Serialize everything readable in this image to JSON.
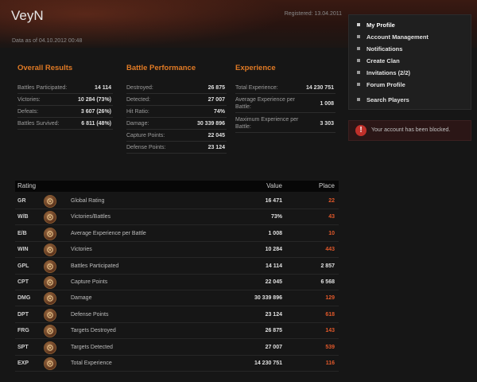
{
  "header": {
    "username": "VeyN",
    "registered": "Registered: 13.04.2011",
    "data_as_of": "Data as of 04.10.2012 00:48"
  },
  "menu": {
    "items": [
      {
        "label": "My Profile",
        "active": true
      },
      {
        "label": "Account Management"
      },
      {
        "label": "Notifications"
      },
      {
        "label": "Create Clan"
      },
      {
        "label": "Invitations (2/2)"
      },
      {
        "label": "Forum Profile"
      },
      {
        "label": "Search Players"
      }
    ]
  },
  "alert": {
    "text": "Your account has been blocked.",
    "icon": "exclamation-icon",
    "color": "#c0302a"
  },
  "overall": {
    "title": "Overall Results",
    "rows": [
      {
        "label": "Battles Participated:",
        "value": "14 114"
      },
      {
        "label": "Victories:",
        "value": "10 284 (73%)"
      },
      {
        "label": "Defeats:",
        "value": "3 607 (26%)"
      },
      {
        "label": "Battles Survived:",
        "value": "6 811 (48%)"
      }
    ]
  },
  "battle": {
    "title": "Battle Performance",
    "rows": [
      {
        "label": "Destroyed:",
        "value": "26 875"
      },
      {
        "label": "Detected:",
        "value": "27 007"
      },
      {
        "label": "Hit Ratio:",
        "value": "74%"
      },
      {
        "label": "Damage:",
        "value": "30 339 896"
      },
      {
        "label": "Capture Points:",
        "value": "22 045"
      },
      {
        "label": "Defense Points:",
        "value": "23 124"
      }
    ]
  },
  "experience": {
    "title": "Experience",
    "rows": [
      {
        "label": "Total Experience:",
        "value": "14 230 751"
      },
      {
        "label": "Average Experience per Battle:",
        "value": "1 008"
      },
      {
        "label": "Maximum Experience per Battle:",
        "value": "3 303"
      }
    ]
  },
  "rating": {
    "headers": {
      "rating": "Rating",
      "value": "Value",
      "place": "Place"
    },
    "rows": [
      {
        "abbr": "GR",
        "name": "Global Rating",
        "value": "16 471",
        "place": "22",
        "highlight": true
      },
      {
        "abbr": "W/B",
        "name": "Victories/Battles",
        "value": "73%",
        "place": "43",
        "highlight": true
      },
      {
        "abbr": "E/B",
        "name": "Average Experience per Battle",
        "value": "1 008",
        "place": "10",
        "highlight": true
      },
      {
        "abbr": "WIN",
        "name": "Victories",
        "value": "10 284",
        "place": "443",
        "highlight": true
      },
      {
        "abbr": "GPL",
        "name": "Battles Participated",
        "value": "14 114",
        "place": "2 857",
        "highlight": false
      },
      {
        "abbr": "CPT",
        "name": "Capture Points",
        "value": "22 045",
        "place": "6 568",
        "highlight": false
      },
      {
        "abbr": "DMG",
        "name": "Damage",
        "value": "30 339 896",
        "place": "129",
        "highlight": true
      },
      {
        "abbr": "DPT",
        "name": "Defense Points",
        "value": "23 124",
        "place": "618",
        "highlight": true
      },
      {
        "abbr": "FRG",
        "name": "Targets Destroyed",
        "value": "26 875",
        "place": "143",
        "highlight": true
      },
      {
        "abbr": "SPT",
        "name": "Targets Detected",
        "value": "27 007",
        "place": "539",
        "highlight": true
      },
      {
        "abbr": "EXP",
        "name": "Total Experience",
        "value": "14 230 751",
        "place": "116",
        "highlight": true
      }
    ]
  },
  "colors": {
    "accent": "#e07a25",
    "place_highlight": "#e0582a"
  }
}
